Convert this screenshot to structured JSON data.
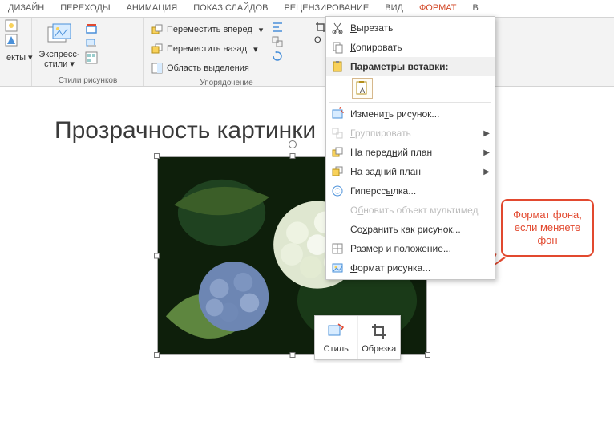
{
  "tabs": {
    "design": "ДИЗАЙН",
    "transitions": "ПЕРЕХОДЫ",
    "animation": "АНИМАЦИЯ",
    "slideshow": "ПОКАЗ СЛАЙДОВ",
    "review": "РЕЦЕНЗИРОВАНИЕ",
    "view": "ВИД",
    "format": "ФОРМАТ",
    "insert_frag": "В"
  },
  "ribbon": {
    "group_effects_frag": "екты ▾",
    "express_styles": "Экспресс-\nстили ▾",
    "styles_group": "Стили рисунков",
    "bring_forward": "Переместить вперед",
    "send_backward": "Переместить назад",
    "selection_pane": "Область выделения",
    "arrange_group": "Упорядочение"
  },
  "slide": {
    "title": "Прозрачность картинки"
  },
  "context_menu": {
    "cut": "Вырезать",
    "copy": "Копировать",
    "paste_opts": "Параметры вставки:",
    "change_picture": "Изменить рисунок...",
    "group": "Группировать",
    "bring_front": "На передний план",
    "send_back": "На задний план",
    "hyperlink": "Гиперссылка...",
    "update_media": "Обновить объект мультимед",
    "save_as_picture": "Сохранить как рисунок...",
    "size_position": "Размер и положение...",
    "format_picture": "Формат рисунка..."
  },
  "callout": {
    "text": "Формат фона,\nесли меняете\nфон"
  },
  "mini_toolbar": {
    "style": "Стиль",
    "crop": "Обрезка"
  }
}
